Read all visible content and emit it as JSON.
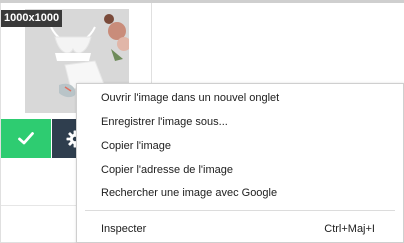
{
  "image_card": {
    "size_badge": "1000x1000"
  },
  "actions": {
    "select_icon": "checkmark-icon",
    "settings_icon": "gear-icon",
    "select_color": "#2ecc71",
    "settings_color": "#2f3e4e"
  },
  "context_menu": {
    "items": [
      {
        "label": "Ouvrir l'image dans un nouvel onglet"
      },
      {
        "label": "Enregistrer l'image sous..."
      },
      {
        "label": "Copier l'image"
      },
      {
        "label": "Copier l'adresse de l'image"
      },
      {
        "label": "Rechercher une image avec Google"
      }
    ],
    "inspect": {
      "label": "Inspecter",
      "shortcut": "Ctrl+Maj+I"
    }
  }
}
